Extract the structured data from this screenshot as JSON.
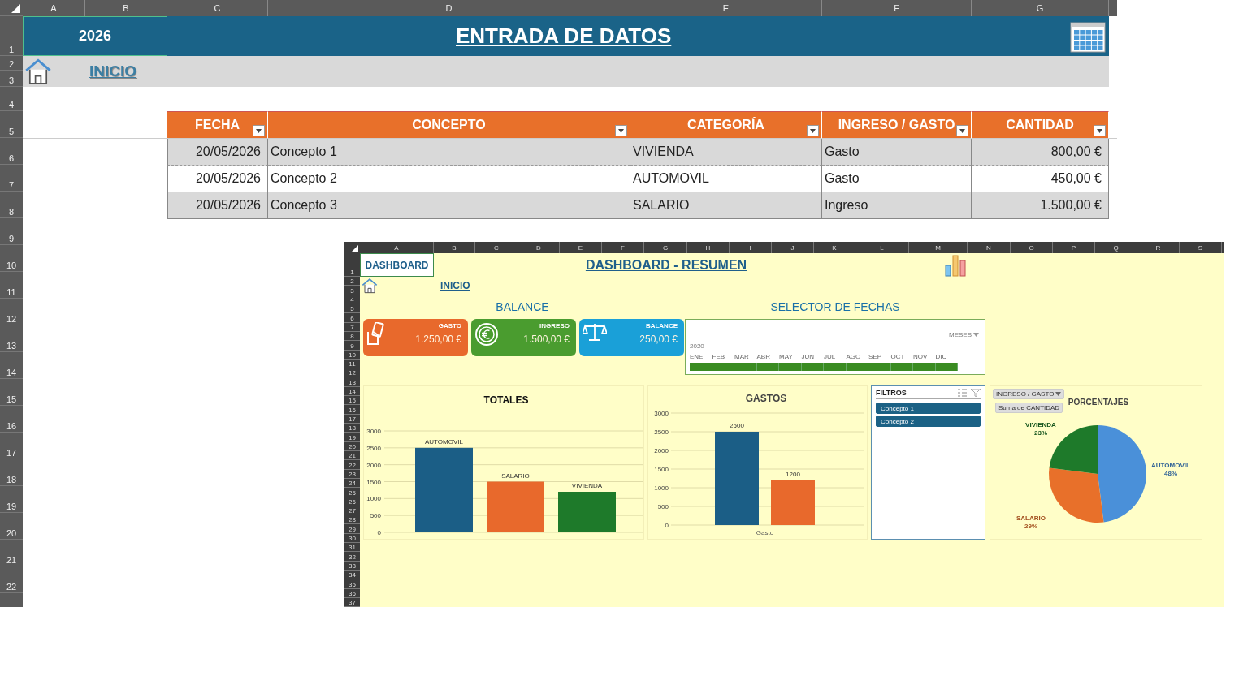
{
  "sheet": {
    "columns": [
      "A",
      "B",
      "C",
      "D",
      "E",
      "F",
      "G"
    ],
    "rows": [
      "1",
      "2",
      "3",
      "4",
      "5",
      "6",
      "7",
      "8",
      "9",
      "10",
      "11",
      "12",
      "13",
      "14",
      "15",
      "16",
      "17",
      "18",
      "19",
      "20",
      "21",
      "22"
    ],
    "year": "2026",
    "title": "ENTRADA DE DATOS",
    "home_link": "INICIO",
    "table": {
      "columns": [
        {
          "label": "FECHA",
          "kind": "date"
        },
        {
          "label": "CONCEPTO",
          "kind": "text"
        },
        {
          "label": "CATEGORÍA",
          "kind": "text"
        },
        {
          "label": "INGRESO / GASTO",
          "kind": "text"
        },
        {
          "label": "CANTIDAD",
          "kind": "money"
        }
      ],
      "rows": [
        [
          "20/05/2026",
          "Concepto 1",
          "VIVIENDA",
          "Gasto",
          "800,00 €"
        ],
        [
          "20/05/2026",
          "Concepto 2",
          "AUTOMOVIL",
          "Gasto",
          "450,00 €"
        ],
        [
          "20/05/2026",
          "Concepto 3",
          "SALARIO",
          "Ingreso",
          "1.500,00 €"
        ]
      ]
    }
  },
  "dashboard": {
    "columns": [
      "A",
      "B",
      "C",
      "D",
      "E",
      "F",
      "G",
      "H",
      "I",
      "J",
      "K",
      "L",
      "M",
      "N",
      "O",
      "P",
      "Q",
      "R",
      "S"
    ],
    "rows": [
      "1",
      "2",
      "3",
      "4",
      "5",
      "6",
      "7",
      "8",
      "9",
      "10",
      "11",
      "12",
      "13",
      "14",
      "15",
      "16",
      "17",
      "18",
      "19",
      "20",
      "21",
      "22",
      "23",
      "24",
      "25",
      "26",
      "27",
      "28",
      "29",
      "30",
      "31",
      "32",
      "33",
      "34",
      "35",
      "36",
      "37"
    ],
    "name_cell": "DASHBOARD",
    "title": "DASHBOARD - RESUMEN",
    "home_link": "INICIO",
    "balance_title": "BALANCE",
    "cards": [
      {
        "kind": "gasto",
        "label": "GASTO",
        "value": "1.250,00 €",
        "color": "#e8692c"
      },
      {
        "kind": "ingreso",
        "label": "INGRESO",
        "value": "1.500,00 €",
        "color": "#4a9c2f"
      },
      {
        "kind": "balance",
        "label": "BALANCE",
        "value": "250,00 €",
        "color": "#1aa0d8"
      }
    ],
    "timeline": {
      "title": "SELECTOR DE FECHAS",
      "level_menu": "MESES",
      "year": "2020",
      "months": [
        {
          "label": "ENE",
          "selected": true
        },
        {
          "label": "FEB",
          "selected": true
        },
        {
          "label": "MAR",
          "selected": true
        },
        {
          "label": "ABR",
          "selected": true
        },
        {
          "label": "MAY",
          "selected": true
        },
        {
          "label": "JUN",
          "selected": true
        },
        {
          "label": "JUL",
          "selected": true
        },
        {
          "label": "AGO",
          "selected": true
        },
        {
          "label": "SEP",
          "selected": true
        },
        {
          "label": "OCT",
          "selected": true
        },
        {
          "label": "NOV",
          "selected": true
        },
        {
          "label": "DIC",
          "selected": true
        }
      ]
    },
    "totales": {
      "chart_data": {
        "type": "bar",
        "title": "TOTALES",
        "ylim": [
          0,
          3000
        ],
        "yticks": [
          0,
          500,
          1000,
          1500,
          2000,
          2500,
          3000
        ],
        "grid": true,
        "series": [
          {
            "name": "AUTOMOVIL",
            "color": "#1b5e86",
            "values": [
              2500
            ]
          },
          {
            "name": "SALARIO",
            "color": "#e8692c",
            "values": [
              1500
            ]
          },
          {
            "name": "VIVIENDA",
            "color": "#1e7a2a",
            "values": [
              1200
            ]
          }
        ]
      }
    },
    "gastos": {
      "chart_data": {
        "type": "bar",
        "title": "GASTOS",
        "categories": [
          "Gasto"
        ],
        "ylim": [
          0,
          3000
        ],
        "yticks": [
          0,
          500,
          1000,
          1500,
          2000,
          2500,
          3000
        ],
        "grid": true,
        "series": [
          {
            "color": "#1b5e86",
            "values": [
              2500
            ]
          },
          {
            "color": "#e8692c",
            "values": [
              1200
            ]
          }
        ],
        "data_labels": true
      }
    },
    "filtros": {
      "title": "FILTROS",
      "items": [
        {
          "label": "Concepto 1",
          "selected": true
        },
        {
          "label": "Concepto 2",
          "selected": true
        }
      ]
    },
    "porcentajes": {
      "filter_button": "INGRESO / GASTO",
      "chart_data": {
        "type": "pie",
        "title": "PORCENTAJES",
        "categories": [
          "AUTOMOVIL",
          "SALARIO",
          "VIVIENDA"
        ],
        "series": [
          {
            "name": "Suma de CANTIDAD",
            "values": [
              48,
              29,
              23
            ]
          }
        ],
        "colors": [
          "#4a90d9",
          "#e8702a",
          "#1e7a2a"
        ],
        "value_labels": [
          "48%",
          "29%",
          "23%"
        ]
      }
    }
  }
}
